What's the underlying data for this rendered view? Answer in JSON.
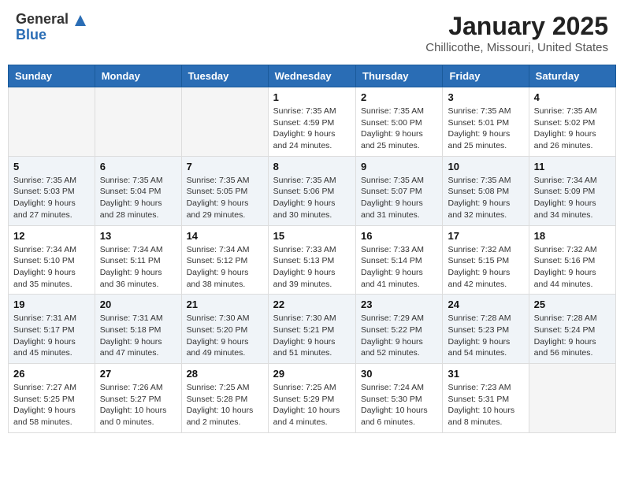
{
  "header": {
    "logo_general": "General",
    "logo_blue": "Blue",
    "title": "January 2025",
    "subtitle": "Chillicothe, Missouri, United States"
  },
  "calendar": {
    "days_of_week": [
      "Sunday",
      "Monday",
      "Tuesday",
      "Wednesday",
      "Thursday",
      "Friday",
      "Saturday"
    ],
    "weeks": [
      [
        {
          "day": "",
          "detail": ""
        },
        {
          "day": "",
          "detail": ""
        },
        {
          "day": "",
          "detail": ""
        },
        {
          "day": "1",
          "detail": "Sunrise: 7:35 AM\nSunset: 4:59 PM\nDaylight: 9 hours\nand 24 minutes."
        },
        {
          "day": "2",
          "detail": "Sunrise: 7:35 AM\nSunset: 5:00 PM\nDaylight: 9 hours\nand 25 minutes."
        },
        {
          "day": "3",
          "detail": "Sunrise: 7:35 AM\nSunset: 5:01 PM\nDaylight: 9 hours\nand 25 minutes."
        },
        {
          "day": "4",
          "detail": "Sunrise: 7:35 AM\nSunset: 5:02 PM\nDaylight: 9 hours\nand 26 minutes."
        }
      ],
      [
        {
          "day": "5",
          "detail": "Sunrise: 7:35 AM\nSunset: 5:03 PM\nDaylight: 9 hours\nand 27 minutes."
        },
        {
          "day": "6",
          "detail": "Sunrise: 7:35 AM\nSunset: 5:04 PM\nDaylight: 9 hours\nand 28 minutes."
        },
        {
          "day": "7",
          "detail": "Sunrise: 7:35 AM\nSunset: 5:05 PM\nDaylight: 9 hours\nand 29 minutes."
        },
        {
          "day": "8",
          "detail": "Sunrise: 7:35 AM\nSunset: 5:06 PM\nDaylight: 9 hours\nand 30 minutes."
        },
        {
          "day": "9",
          "detail": "Sunrise: 7:35 AM\nSunset: 5:07 PM\nDaylight: 9 hours\nand 31 minutes."
        },
        {
          "day": "10",
          "detail": "Sunrise: 7:35 AM\nSunset: 5:08 PM\nDaylight: 9 hours\nand 32 minutes."
        },
        {
          "day": "11",
          "detail": "Sunrise: 7:34 AM\nSunset: 5:09 PM\nDaylight: 9 hours\nand 34 minutes."
        }
      ],
      [
        {
          "day": "12",
          "detail": "Sunrise: 7:34 AM\nSunset: 5:10 PM\nDaylight: 9 hours\nand 35 minutes."
        },
        {
          "day": "13",
          "detail": "Sunrise: 7:34 AM\nSunset: 5:11 PM\nDaylight: 9 hours\nand 36 minutes."
        },
        {
          "day": "14",
          "detail": "Sunrise: 7:34 AM\nSunset: 5:12 PM\nDaylight: 9 hours\nand 38 minutes."
        },
        {
          "day": "15",
          "detail": "Sunrise: 7:33 AM\nSunset: 5:13 PM\nDaylight: 9 hours\nand 39 minutes."
        },
        {
          "day": "16",
          "detail": "Sunrise: 7:33 AM\nSunset: 5:14 PM\nDaylight: 9 hours\nand 41 minutes."
        },
        {
          "day": "17",
          "detail": "Sunrise: 7:32 AM\nSunset: 5:15 PM\nDaylight: 9 hours\nand 42 minutes."
        },
        {
          "day": "18",
          "detail": "Sunrise: 7:32 AM\nSunset: 5:16 PM\nDaylight: 9 hours\nand 44 minutes."
        }
      ],
      [
        {
          "day": "19",
          "detail": "Sunrise: 7:31 AM\nSunset: 5:17 PM\nDaylight: 9 hours\nand 45 minutes."
        },
        {
          "day": "20",
          "detail": "Sunrise: 7:31 AM\nSunset: 5:18 PM\nDaylight: 9 hours\nand 47 minutes."
        },
        {
          "day": "21",
          "detail": "Sunrise: 7:30 AM\nSunset: 5:20 PM\nDaylight: 9 hours\nand 49 minutes."
        },
        {
          "day": "22",
          "detail": "Sunrise: 7:30 AM\nSunset: 5:21 PM\nDaylight: 9 hours\nand 51 minutes."
        },
        {
          "day": "23",
          "detail": "Sunrise: 7:29 AM\nSunset: 5:22 PM\nDaylight: 9 hours\nand 52 minutes."
        },
        {
          "day": "24",
          "detail": "Sunrise: 7:28 AM\nSunset: 5:23 PM\nDaylight: 9 hours\nand 54 minutes."
        },
        {
          "day": "25",
          "detail": "Sunrise: 7:28 AM\nSunset: 5:24 PM\nDaylight: 9 hours\nand 56 minutes."
        }
      ],
      [
        {
          "day": "26",
          "detail": "Sunrise: 7:27 AM\nSunset: 5:25 PM\nDaylight: 9 hours\nand 58 minutes."
        },
        {
          "day": "27",
          "detail": "Sunrise: 7:26 AM\nSunset: 5:27 PM\nDaylight: 10 hours\nand 0 minutes."
        },
        {
          "day": "28",
          "detail": "Sunrise: 7:25 AM\nSunset: 5:28 PM\nDaylight: 10 hours\nand 2 minutes."
        },
        {
          "day": "29",
          "detail": "Sunrise: 7:25 AM\nSunset: 5:29 PM\nDaylight: 10 hours\nand 4 minutes."
        },
        {
          "day": "30",
          "detail": "Sunrise: 7:24 AM\nSunset: 5:30 PM\nDaylight: 10 hours\nand 6 minutes."
        },
        {
          "day": "31",
          "detail": "Sunrise: 7:23 AM\nSunset: 5:31 PM\nDaylight: 10 hours\nand 8 minutes."
        },
        {
          "day": "",
          "detail": ""
        }
      ]
    ]
  }
}
